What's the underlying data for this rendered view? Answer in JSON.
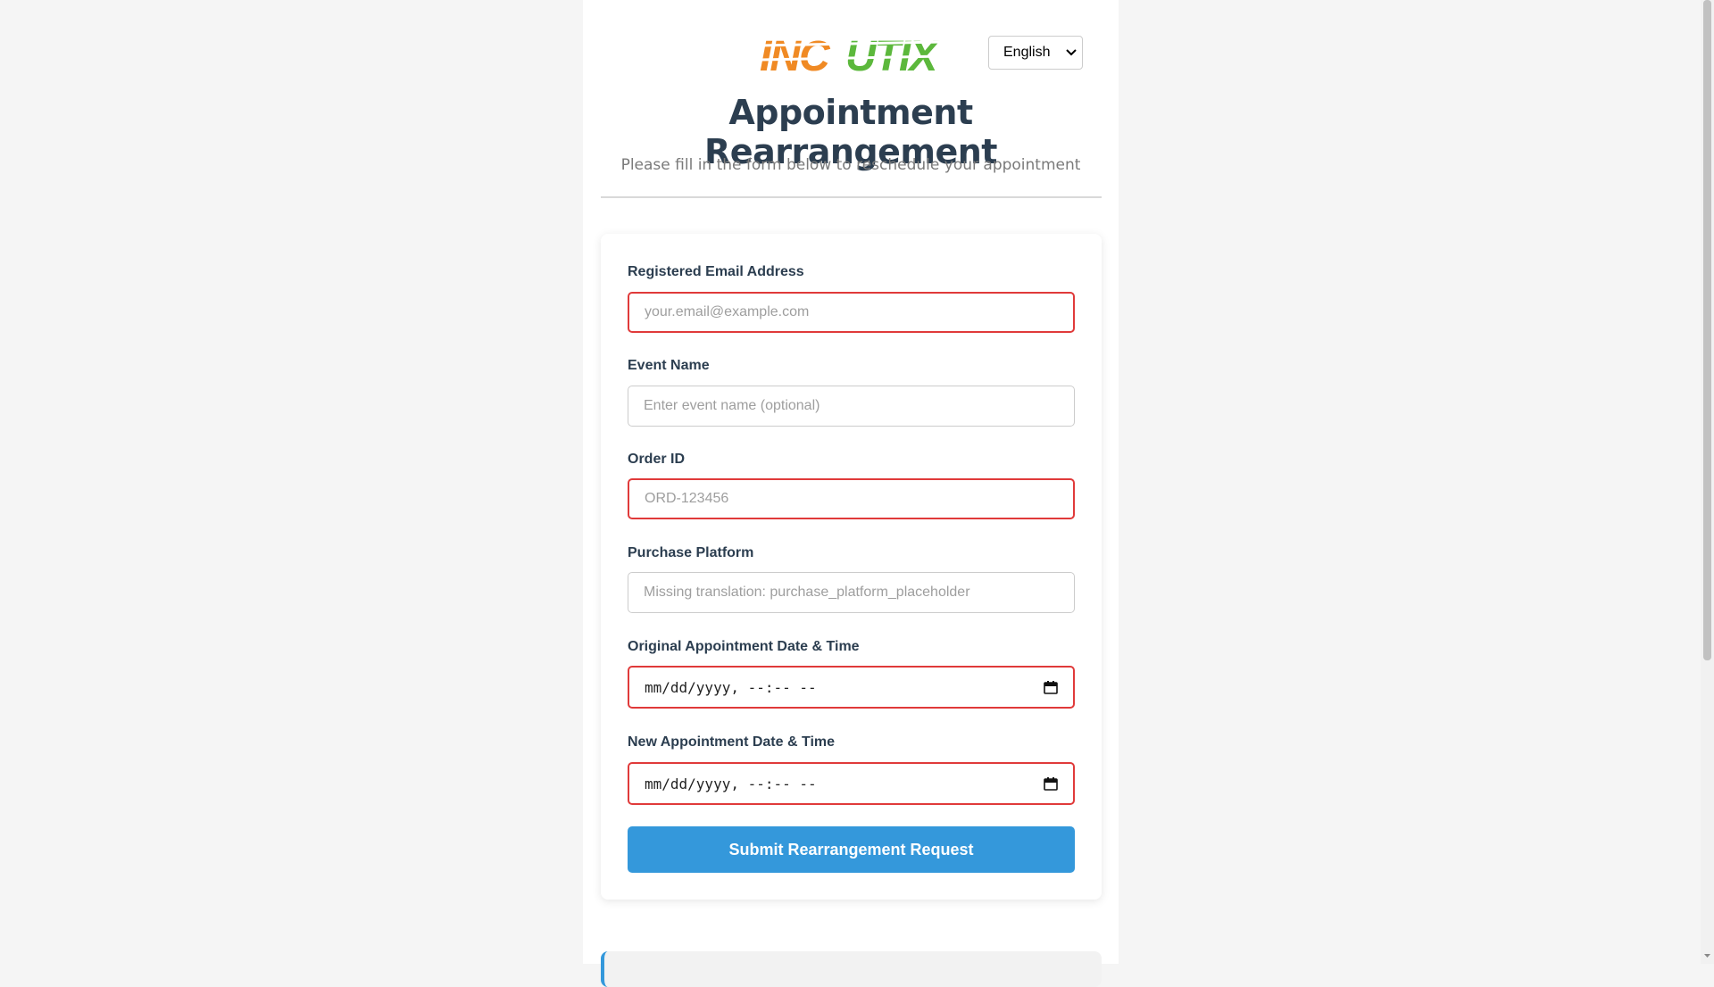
{
  "header": {
    "logo_text": "INCUTIX",
    "language": {
      "selected": "English"
    }
  },
  "page": {
    "title": "Appointment Rearrangement",
    "subtitle": "Please fill in the form below to reschedule your appointment"
  },
  "form": {
    "email": {
      "label": "Registered Email Address",
      "placeholder": "your.email@example.com"
    },
    "event_name": {
      "label": "Event Name",
      "placeholder": "Enter event name (optional)"
    },
    "order_id": {
      "label": "Order ID",
      "placeholder": "ORD-123456"
    },
    "purchase_platform": {
      "label": "Purchase Platform",
      "placeholder": "Missing translation: purchase_platform_placeholder"
    },
    "original_datetime": {
      "label": "Original Appointment Date & Time",
      "value": "mm/dd/yyyy, --:-- --"
    },
    "new_datetime": {
      "label": "New Appointment Date & Time",
      "value": "mm/dd/yyyy, --:-- --"
    },
    "submit_label": "Submit Rearrangement Request"
  },
  "colors": {
    "accent": "#3498db",
    "heading": "#2c3e50",
    "invalid_border": "#e03a3a",
    "logo_orange": "#f08a24",
    "logo_green": "#5cb83c"
  }
}
